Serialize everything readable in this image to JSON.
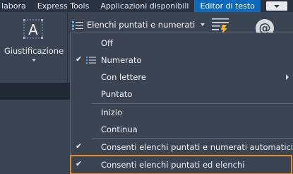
{
  "tabs": [
    {
      "label": "labora"
    },
    {
      "label": "Express Tools"
    },
    {
      "label": "Applicazioni disponibili"
    },
    {
      "label": "Editor di testo",
      "active": true
    }
  ],
  "ribbon": {
    "justify_label": "Giustificazione",
    "bullets_label": "Elenchi puntati e numerati",
    "at_glyph": "@"
  },
  "menu": {
    "items": [
      {
        "label": "Off",
        "checked": false
      },
      {
        "label": "Numerato",
        "checked": true,
        "icon": "numbered-list-icon"
      },
      {
        "label": "Con lettere",
        "submenu": true
      },
      {
        "label": "Puntato"
      },
      {
        "label": "Inizio"
      },
      {
        "label": "Continua"
      },
      {
        "label": "Consenti elenchi puntati e numerati automatici",
        "checked": true
      },
      {
        "label": "Consenti elenchi puntati ed elenchi",
        "checked": true,
        "highlighted": true
      }
    ]
  },
  "colors": {
    "active_tab": "#0a69b8",
    "highlight_border": "#e58a2e"
  }
}
